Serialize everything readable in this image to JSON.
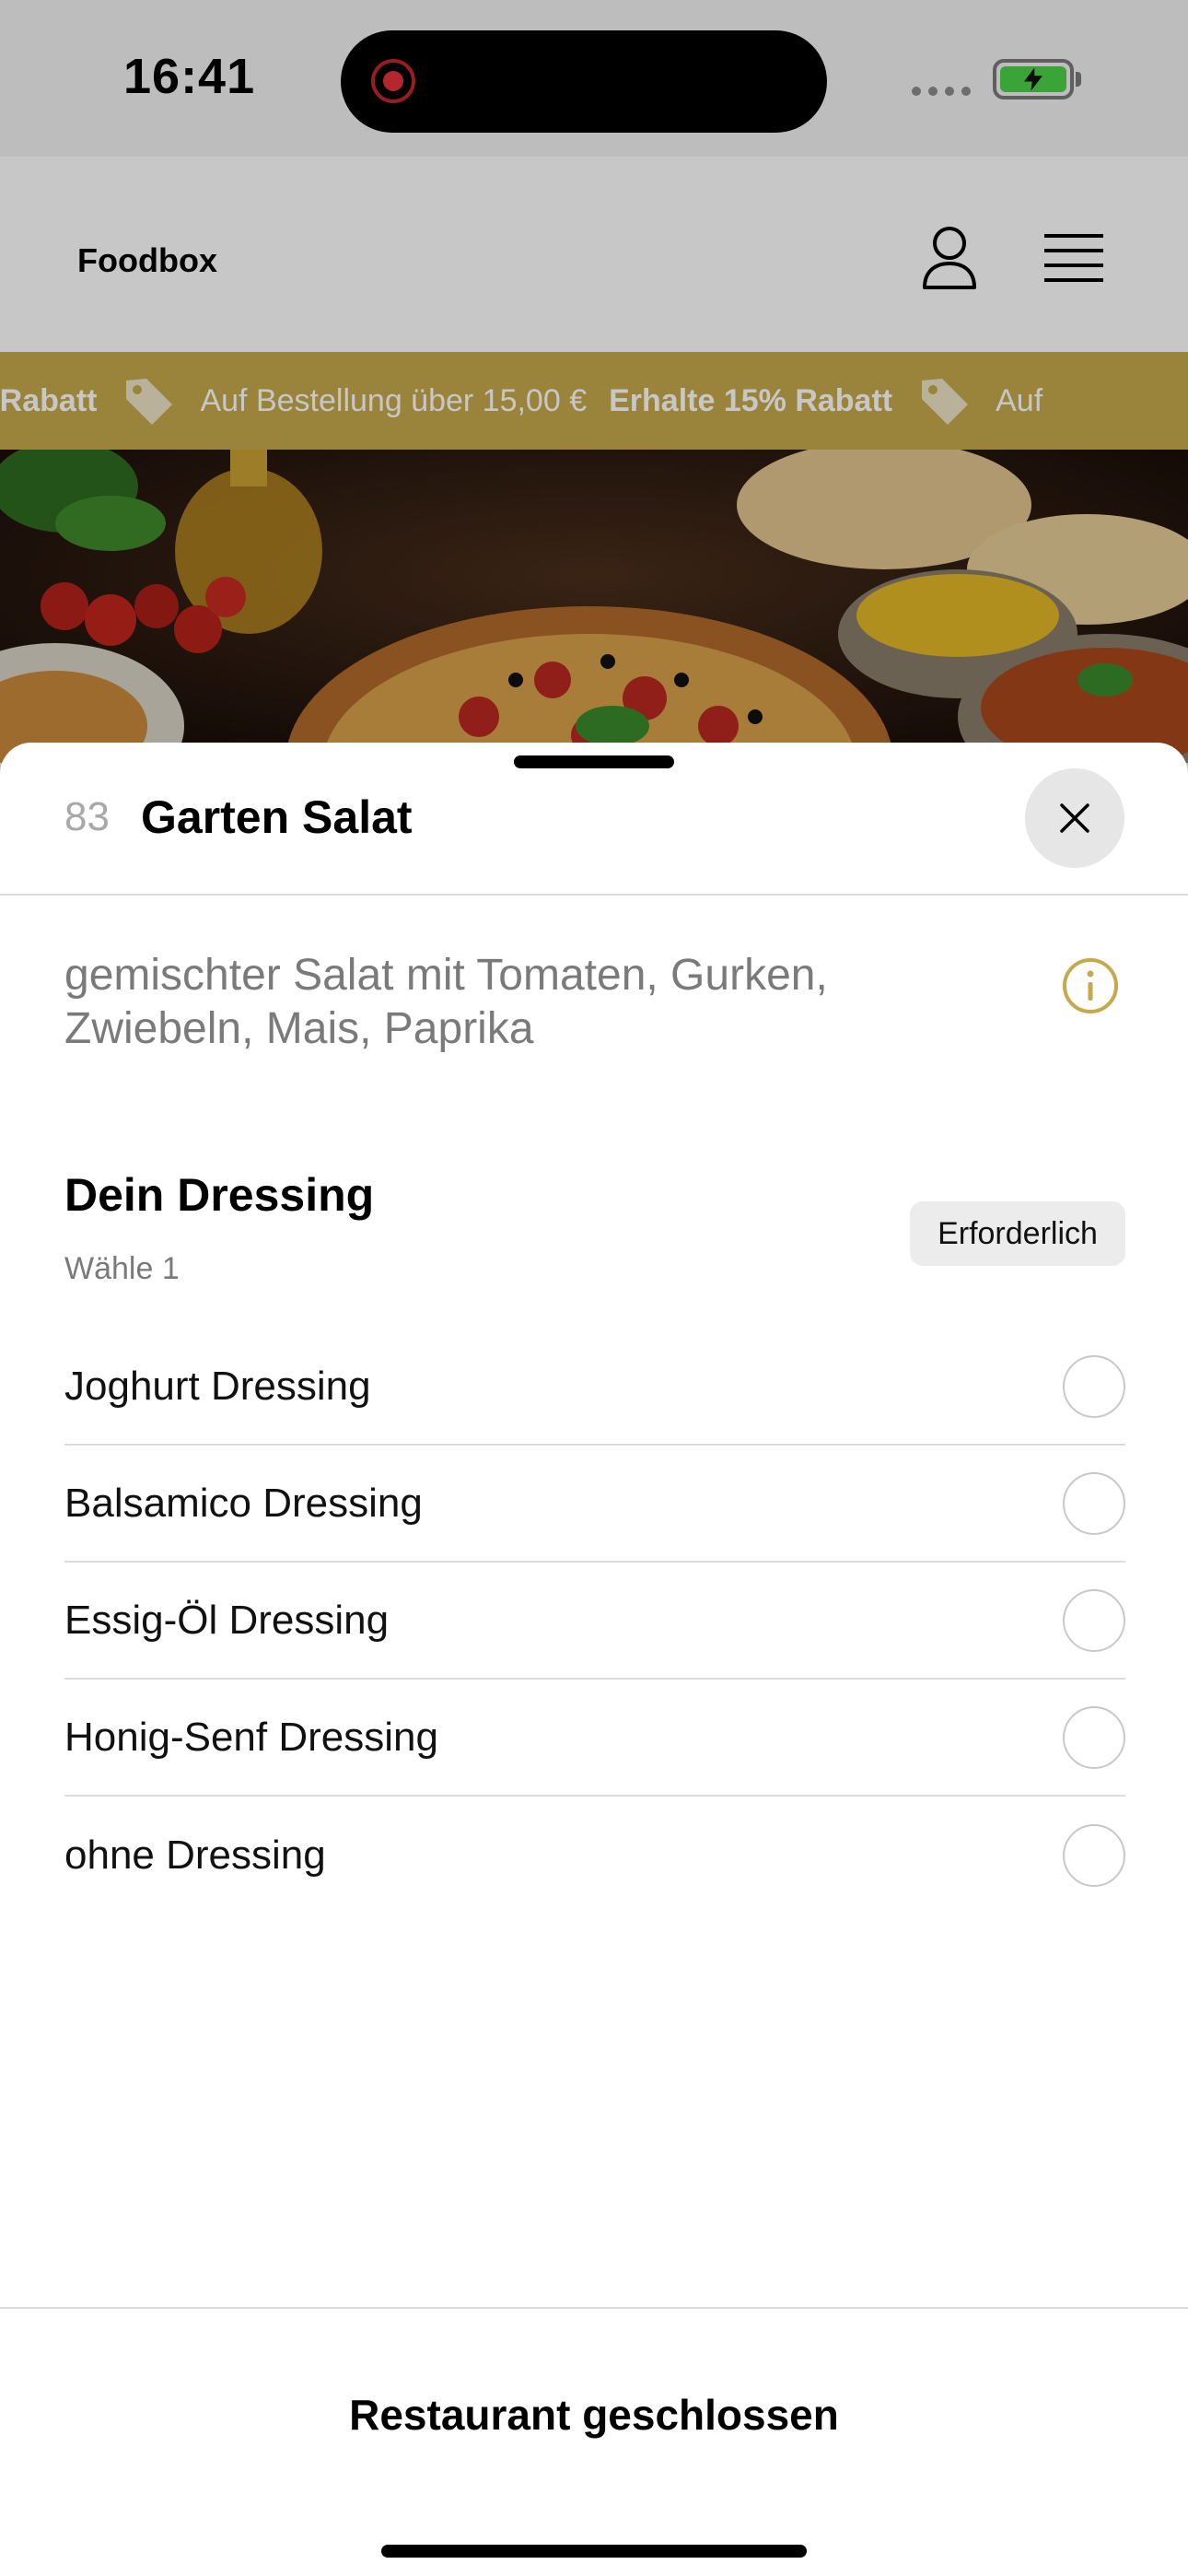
{
  "status_bar": {
    "time": "16:41"
  },
  "header": {
    "brand": "Foodbox"
  },
  "promo": {
    "items": [
      {
        "strong": "% Rabatt",
        "text": ""
      },
      {
        "strong": "",
        "text": "Auf Bestellung über 15,00 €"
      },
      {
        "strong": "Erhalte 15% Rabatt",
        "text": ""
      },
      {
        "strong": "",
        "text": "Auf"
      }
    ]
  },
  "sheet": {
    "item_number": "83",
    "item_title": "Garten Salat",
    "description": "gemischter Salat mit Tomaten, Gurken, Zwiebeln, Mais, Paprika",
    "section": {
      "title": "Dein Dressing",
      "subtitle": "Wähle 1",
      "badge": "Erforderlich"
    },
    "options": [
      {
        "label": "Joghurt Dressing"
      },
      {
        "label": "Balsamico Dressing"
      },
      {
        "label": "Essig-Öl Dressing"
      },
      {
        "label": "Honig-Senf Dressing"
      },
      {
        "label": "ohne Dressing"
      }
    ],
    "footer_label": "Restaurant geschlossen"
  },
  "colors": {
    "accent_gold": "#c6a94d",
    "battery_green": "#4bd34a",
    "record_red": "#e6333a"
  },
  "icons": {
    "user": "user-icon",
    "menu": "menu-icon",
    "tag": "tag-icon",
    "close": "close-icon",
    "info": "info-icon"
  }
}
